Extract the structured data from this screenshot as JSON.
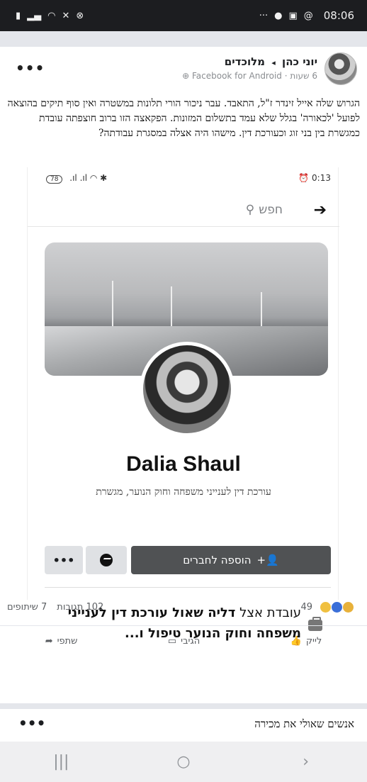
{
  "status_bar": {
    "left_icons": [
      "battery-icon",
      "signal-icon",
      "wifi-icon",
      "mute-icon",
      "do-not-disturb-icon"
    ],
    "right_icons": [
      "more-notifications-icon",
      "facebook-notification-icon",
      "gallery-notification-icon",
      "at-icon"
    ],
    "time": "08:06"
  },
  "post": {
    "author": "יוני כהן",
    "group": "מלוכדים",
    "time_ago": "6 שעות",
    "source": "Facebook for Android",
    "text": "הגרוש שלה אייל זינדר ז\"ל, התאבד. עבר ניכור הורי תלונות במשטרה ואין סוף תיקים בהוצאה לפועל 'לכאורה' בגלל שלא עמד בתשלום המזונות. הפקאצה הזו ברוב חוצפתה עובדת כמגשרת בין בני זוג וכעורכת דין. מישהו היה אצלה במסגרת עבודתה?",
    "more_label": "•••"
  },
  "embedded": {
    "status": {
      "battery": "78",
      "timer": "0:13"
    },
    "search_placeholder": "חפש",
    "profile": {
      "name": "Dalia Shaul",
      "bio": "עורכת דין לענייני משפחה וחוק הנוער, מגשרת",
      "add_friend_label": "הוספה לחברים",
      "more_label": "•••",
      "work_prefix": "עובדת אצל",
      "work_bold": "דליה שאול עורכת דין לענייני משפחה וחוק הנוער טיפול ו..."
    }
  },
  "engagement": {
    "reactions_count": "49",
    "comments": "102 תגובות",
    "shares": "7 שיתופים",
    "like_label": "לייק",
    "comment_label": "הגיבי",
    "share_label": "שתפי"
  },
  "people_you_may_know": {
    "title": "אנשים שאולי את מכירה",
    "more_label": "•••"
  },
  "navigation": {
    "recent": "|||",
    "home": "○",
    "back": "›"
  },
  "colors": {
    "status_bar_bg": "#1c1d20",
    "add_button_bg": "#505254",
    "secondary_button_bg": "#dfe1e4",
    "divider": "#e4e6eb"
  }
}
